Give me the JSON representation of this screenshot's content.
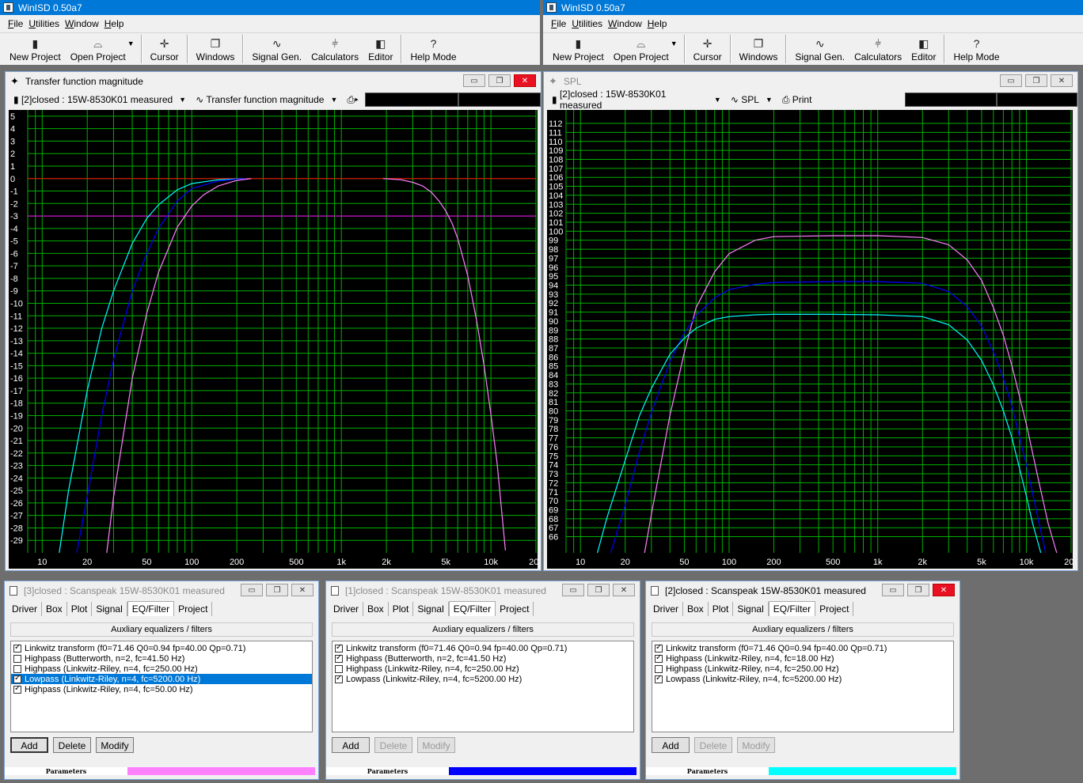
{
  "app": {
    "title": "WinISD 0.50a7",
    "menu": [
      "File",
      "Utilities",
      "Window",
      "Help"
    ],
    "toolbar": [
      {
        "label": "New Project",
        "icon": "new-project-icon"
      },
      {
        "label": "Open Project",
        "icon": "open-project-icon"
      },
      {
        "label": "Cursor",
        "icon": "cursor-icon"
      },
      {
        "label": "Windows",
        "icon": "windows-icon"
      },
      {
        "label": "Signal Gen.",
        "icon": "signal-gen-icon"
      },
      {
        "label": "Calculators",
        "icon": "calculators-icon"
      },
      {
        "label": "Editor",
        "icon": "editor-icon"
      },
      {
        "label": "Help Mode",
        "icon": "help-icon"
      }
    ]
  },
  "left_plot": {
    "title": "Transfer function magnitude",
    "project_select": "[2]closed : 15W-8530K01 measured",
    "plot_select": "Transfer function magnitude"
  },
  "right_plot": {
    "title": "SPL",
    "project_select": "[2]closed : 15W-8530K01 measured",
    "plot_select": "SPL",
    "print_label": "Print"
  },
  "chart_data": [
    {
      "type": "line",
      "title": "Transfer function magnitude",
      "xscale": "log",
      "xlim": [
        8,
        20000
      ],
      "ylim": [
        -30,
        5.5
      ],
      "x_tick_labels": [
        "10",
        "20",
        "50",
        "100",
        "200",
        "500",
        "1k",
        "2k",
        "5k",
        "10k",
        "20k"
      ],
      "y_ticks": [
        5,
        4,
        3,
        2,
        1,
        0,
        -1,
        -2,
        -3,
        -4,
        -5,
        -6,
        -7,
        -8,
        -9,
        -10,
        -11,
        -12,
        -13,
        -14,
        -15,
        -16,
        -17,
        -18,
        -19,
        -20,
        -21,
        -22,
        -23,
        -24,
        -25,
        -26,
        -27,
        -28,
        -29
      ],
      "grid": true,
      "reference_lines": [
        {
          "y": 0,
          "color": "#ff0000"
        },
        {
          "y": -3,
          "color": "#ff00ff"
        }
      ],
      "series": [
        {
          "color": "#00ffff",
          "x": [
            13,
            15,
            20,
            25,
            30,
            40,
            50,
            60,
            80,
            100,
            150,
            220
          ],
          "y": [
            -30,
            -25,
            -17,
            -12,
            -9,
            -5.2,
            -3.2,
            -2.1,
            -0.9,
            -0.4,
            -0.1,
            0
          ]
        },
        {
          "color": "#0000ff",
          "x": [
            17,
            20,
            25,
            30,
            40,
            50,
            60,
            80,
            100,
            150,
            200,
            230
          ],
          "y": [
            -30,
            -25.5,
            -19,
            -14.5,
            -9,
            -6,
            -4,
            -1.8,
            -0.8,
            -0.2,
            -0.05,
            0
          ]
        },
        {
          "color": "#ff80ff",
          "x": [
            27,
            30,
            40,
            50,
            60,
            80,
            100,
            120,
            150,
            200,
            250
          ],
          "y": [
            -30,
            -25.5,
            -16,
            -10.8,
            -7.5,
            -3.9,
            -2.2,
            -1.3,
            -0.6,
            -0.15,
            0
          ]
        },
        {
          "color": "#ff80ff",
          "x": [
            1900,
            2500,
            3000,
            3500,
            4000,
            4500,
            5000,
            5500,
            6000,
            7000,
            8000,
            9000,
            10000,
            11000,
            12500
          ],
          "y": [
            0,
            -0.1,
            -0.3,
            -0.6,
            -1.1,
            -1.8,
            -2.6,
            -3.6,
            -4.8,
            -7.8,
            -11.3,
            -15,
            -18.9,
            -22.8,
            -29.8
          ]
        }
      ]
    },
    {
      "type": "line",
      "title": "SPL",
      "xscale": "log",
      "xlim": [
        8,
        20000
      ],
      "ylim": [
        64.2,
        113.5
      ],
      "x_tick_labels": [
        "10",
        "20",
        "50",
        "100",
        "200",
        "500",
        "1k",
        "2k",
        "5k",
        "10k",
        "20k"
      ],
      "y_ticks": [
        112,
        111,
        110,
        109,
        108,
        107,
        106,
        105,
        104,
        103,
        102,
        101,
        100,
        99,
        98,
        97,
        96,
        95,
        94,
        93,
        92,
        91,
        90,
        89,
        88,
        87,
        86,
        85,
        84,
        83,
        82,
        81,
        80,
        79,
        78,
        77,
        76,
        75,
        74,
        73,
        72,
        71,
        70,
        69,
        68,
        67,
        66
      ],
      "grid": true,
      "series": [
        {
          "color": "#ff80ff",
          "x": [
            27,
            30,
            40,
            50,
            60,
            80,
            100,
            150,
            200,
            500,
            1000,
            2000,
            3000,
            4000,
            5000,
            6000,
            7000,
            8000,
            10000,
            12000,
            14000,
            16000
          ],
          "y": [
            64.2,
            68.5,
            79.5,
            86.5,
            91.5,
            95.5,
            97.5,
            99,
            99.4,
            99.5,
            99.5,
            99.3,
            98.5,
            96.8,
            94.5,
            91.5,
            88.4,
            85,
            78.5,
            72.5,
            67.5,
            64.2
          ]
        },
        {
          "color": "#0000ff",
          "x": [
            16,
            20,
            25,
            30,
            40,
            50,
            60,
            80,
            100,
            150,
            200,
            500,
            1000,
            2000,
            3000,
            4000,
            5000,
            6000,
            7000,
            8000,
            10000,
            12000,
            13500
          ],
          "y": [
            64.2,
            69.5,
            75.5,
            79.8,
            85.5,
            88.7,
            90.6,
            92.6,
            93.5,
            94.1,
            94.3,
            94.4,
            94.4,
            94.2,
            93.3,
            91.6,
            89.4,
            86.6,
            83.6,
            80.5,
            74,
            68,
            64.2
          ]
        },
        {
          "color": "#00ffff",
          "x": [
            13,
            15,
            20,
            25,
            30,
            40,
            50,
            60,
            80,
            100,
            150,
            200,
            500,
            1000,
            2000,
            3000,
            4000,
            5000,
            6000,
            7000,
            8000,
            10000,
            11000,
            12500
          ],
          "y": [
            64.2,
            68,
            74.5,
            79.5,
            82.5,
            86.3,
            88.1,
            89.2,
            90.2,
            90.5,
            90.7,
            90.75,
            90.75,
            90.7,
            90.5,
            89.6,
            87.9,
            85.6,
            82.9,
            80,
            77,
            70.5,
            67.5,
            64.2
          ]
        }
      ]
    }
  ],
  "aux_windows": [
    {
      "title": "[3]closed : Scanspeak 15W-8530K01 measured",
      "active": false,
      "tabs": [
        "Driver",
        "Box",
        "Plot",
        "Signal",
        "EQ/Filter",
        "Project"
      ],
      "selected_tab": "EQ/Filter",
      "group_label": "Auxliary equalizers / filters",
      "items": [
        {
          "checked": true,
          "label": "Linkwitz transform (f0=71.46 Q0=0.94 fp=40.00 Qp=0.71)",
          "selected": false
        },
        {
          "checked": false,
          "label": "Highpass (Butterworth, n=2, fc=41.50 Hz)",
          "selected": false
        },
        {
          "checked": false,
          "label": "Highpass (Linkwitz-Riley, n=4, fc=250.00 Hz)",
          "selected": false
        },
        {
          "checked": true,
          "label": "Lowpass (Linkwitz-Riley, n=4, fc=5200.00 Hz)",
          "selected": true
        },
        {
          "checked": true,
          "label": "Highpass (Linkwitz-Riley, n=4, fc=50.00 Hz)",
          "selected": false
        }
      ],
      "buttons": [
        {
          "label": "Add",
          "enabled": true
        },
        {
          "label": "Delete",
          "enabled": true
        },
        {
          "label": "Modify",
          "enabled": true
        }
      ],
      "param_label": "Parameters",
      "color": "#ff80ff"
    },
    {
      "title": "[1]closed : Scanspeak 15W-8530K01 measured",
      "active": false,
      "tabs": [
        "Driver",
        "Box",
        "Plot",
        "Signal",
        "EQ/Filter",
        "Project"
      ],
      "selected_tab": "EQ/Filter",
      "group_label": "Auxliary equalizers / filters",
      "items": [
        {
          "checked": true,
          "label": "Linkwitz transform (f0=71.46 Q0=0.94 fp=40.00 Qp=0.71)",
          "selected": false
        },
        {
          "checked": true,
          "label": "Highpass (Butterworth, n=2, fc=41.50 Hz)",
          "selected": false
        },
        {
          "checked": false,
          "label": "Highpass (Linkwitz-Riley, n=4, fc=250.00 Hz)",
          "selected": false
        },
        {
          "checked": true,
          "label": "Lowpass (Linkwitz-Riley, n=4, fc=5200.00 Hz)",
          "selected": false
        }
      ],
      "buttons": [
        {
          "label": "Add",
          "enabled": true
        },
        {
          "label": "Delete",
          "enabled": false
        },
        {
          "label": "Modify",
          "enabled": false
        }
      ],
      "param_label": "Parameters",
      "color": "#0000ff"
    },
    {
      "title": "[2]closed : Scanspeak 15W-8530K01 measured",
      "active": true,
      "tabs": [
        "Driver",
        "Box",
        "Plot",
        "Signal",
        "EQ/Filter",
        "Project"
      ],
      "selected_tab": "EQ/Filter",
      "group_label": "Auxliary equalizers / filters",
      "items": [
        {
          "checked": true,
          "label": "Linkwitz transform (f0=71.46 Q0=0.94 fp=40.00 Qp=0.71)",
          "selected": false
        },
        {
          "checked": true,
          "label": "Highpass (Linkwitz-Riley, n=4, fc=18.00 Hz)",
          "selected": false
        },
        {
          "checked": false,
          "label": "Highpass (Linkwitz-Riley, n=4, fc=250.00 Hz)",
          "selected": false
        },
        {
          "checked": true,
          "label": "Lowpass (Linkwitz-Riley, n=4, fc=5200.00 Hz)",
          "selected": false
        }
      ],
      "buttons": [
        {
          "label": "Add",
          "enabled": true
        },
        {
          "label": "Delete",
          "enabled": false
        },
        {
          "label": "Modify",
          "enabled": false
        }
      ],
      "param_label": "Parameters",
      "color": "#00ffff"
    }
  ]
}
